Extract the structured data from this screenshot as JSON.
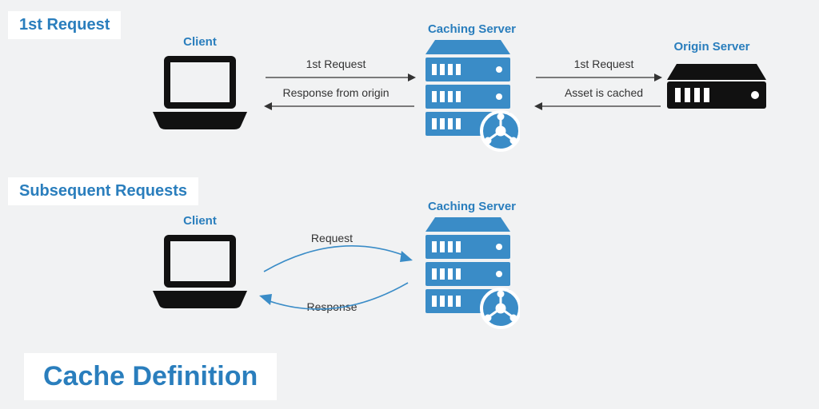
{
  "colors": {
    "accent": "#2a7ebd",
    "ink": "#1a1a1a",
    "bg": "#f1f2f3"
  },
  "section1": {
    "header": "1st Request"
  },
  "section2": {
    "header": "Subsequent Requests"
  },
  "labels": {
    "client1": "Client",
    "client2": "Client",
    "caching1": "Caching Server",
    "caching2": "Caching Server",
    "origin": "Origin Server"
  },
  "arrows": {
    "req1_left_top": "1st Request",
    "req1_left_bot": "Response from origin",
    "req1_right_top": "1st Request",
    "req1_right_bot": "Asset is cached",
    "req2_top": "Request",
    "req2_bot": "Response"
  },
  "title": "Cache Definition"
}
